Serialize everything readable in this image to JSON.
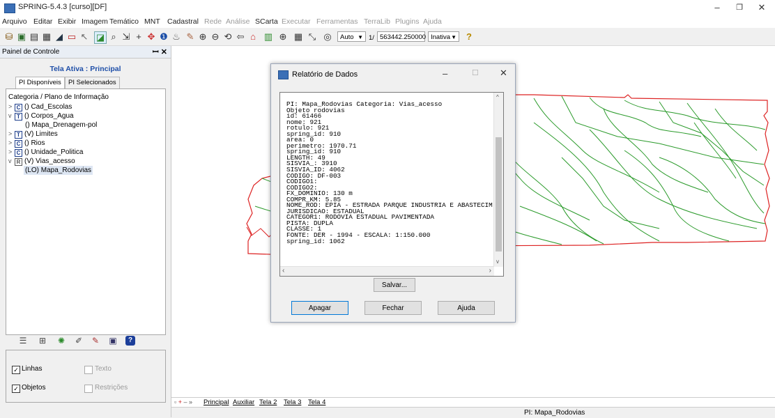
{
  "window": {
    "title": "SPRING-5.4.3 [curso][DF]",
    "minimize": "–",
    "restore": "❐",
    "close": "✕"
  },
  "menu": [
    "Arquivo",
    "Editar",
    "Exibir",
    "Imagem",
    "Temático",
    "MNT",
    "Cadastral",
    "Rede",
    "Análise",
    "SCarta",
    "Executar",
    "Ferramentas",
    "TerraLib",
    "Plugins",
    "Ajuda"
  ],
  "toolbar": {
    "mode_combo": "Auto",
    "scale_prefix": "1/",
    "scale_value": "563442.250000",
    "state_combo": "Inativa",
    "help_icon": "?"
  },
  "panel": {
    "title": "Painel de Controle",
    "tela_ativa": "Tela Ativa : Principal",
    "tabs": [
      "PI Disponíveis",
      "PI Selecionados"
    ],
    "tree_header": "Categoria / Plano de Informação",
    "tree": [
      {
        "chev": ">",
        "cat": "C",
        "label": "() Cad_Escolas"
      },
      {
        "chev": "v",
        "cat": "T",
        "label": "() Corpos_Agua"
      },
      {
        "chev": "",
        "cat": "",
        "label": "() Mapa_Drenagem-pol"
      },
      {
        "chev": ">",
        "cat": "T",
        "label": "(V) Limites"
      },
      {
        "chev": ">",
        "cat": "C",
        "label": "() Rios"
      },
      {
        "chev": ">",
        "cat": "C",
        "label": "() Unidade_Politica"
      },
      {
        "chev": "v",
        "cat": "R",
        "label": "(V) Vias_acesso"
      },
      {
        "chev": "",
        "cat": "",
        "label": "(LO) Mapa_Rodovias"
      }
    ],
    "options": {
      "linhas": "Linhas",
      "texto": "Texto",
      "objetos": "Objetos",
      "restricoes": "Restrições"
    }
  },
  "dialog": {
    "title": "Relatório de Dados",
    "report_lines": [
      "PI: Mapa_Rodovias Categoria: Vias_acesso",
      "Objeto rodovias",
      "id: 61466",
      "nome: 921",
      "rotulo: 921",
      "spring_id: 910",
      "area: 0",
      "perimetro: 1970.71",
      "spring_id: 910",
      "LENGTH: 49",
      "SISVIA_: 3910",
      "SISVIA_ID: 4062",
      "CODIGO: DF-003",
      "CODIGO1:",
      "CODIGO2:",
      "FX_DOMINIO: 130 m",
      "COMPR_KM: 5.85",
      "NOME_ROD: EPIA - ESTRADA PARQUE INDUSTRIA E ABASTECIM",
      "JURISDICAO: ESTADUAL",
      "CATEGOR1: RODOVIA ESTADUAL PAVIMENTADA",
      "PISTA: DUPLA",
      "CLASSE: 1",
      "FONTE: DER - 1994 - ESCALA: 1:150.000",
      "spring_id: 1062"
    ],
    "salvar": "Salvar...",
    "apagar": "Apagar",
    "fechar": "Fechar",
    "ajuda": "Ajuda"
  },
  "bottom_tabs": [
    "Principal",
    "Auxiliar",
    "Tela 2",
    "Tela 3",
    "Tela 4"
  ],
  "status": {
    "pi": "PI: Mapa_Rodovias"
  }
}
